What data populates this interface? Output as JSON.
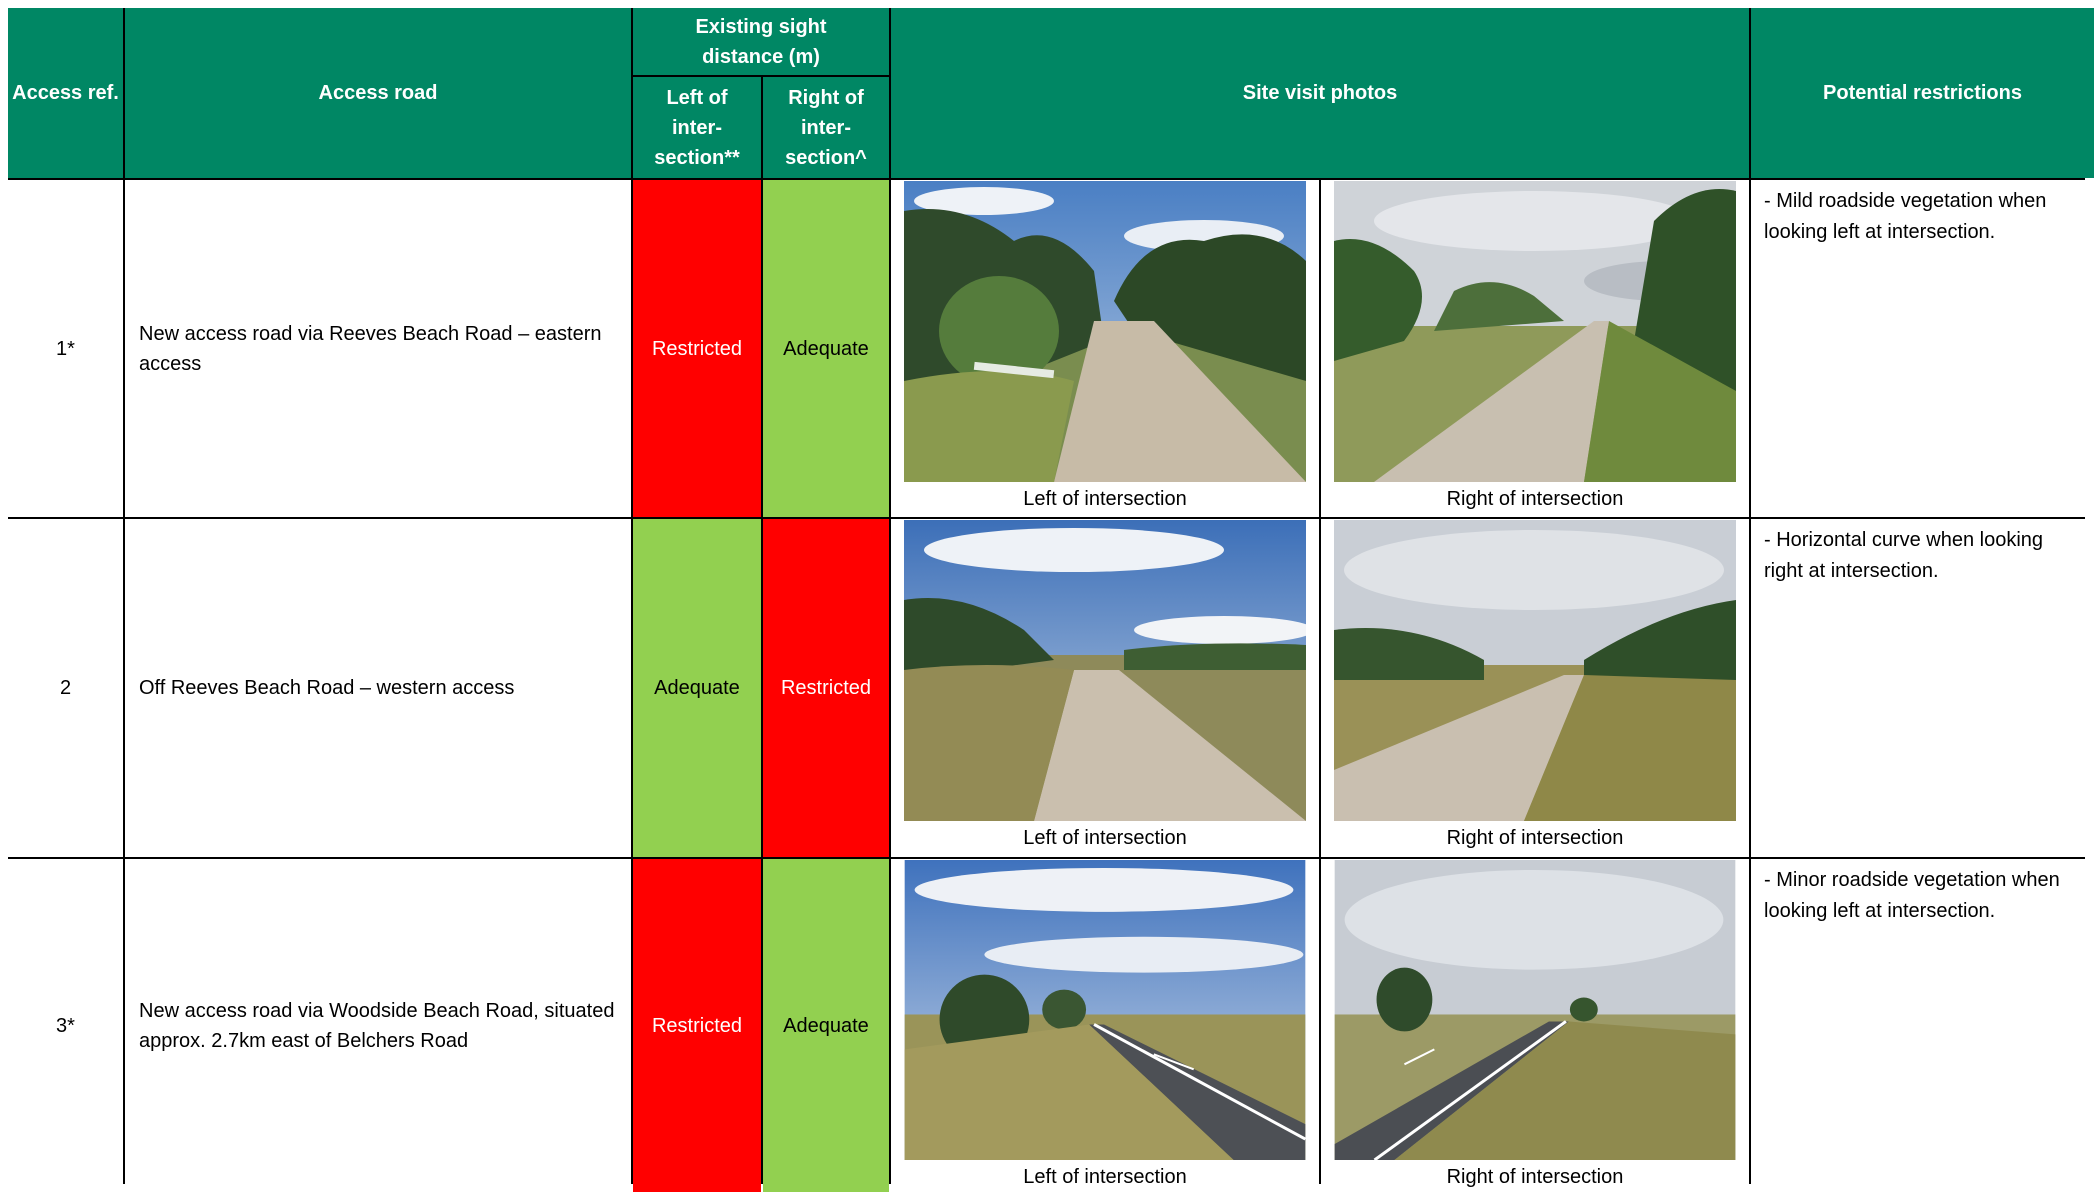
{
  "header": {
    "access_ref": "Access ref.",
    "access_road": "Access road",
    "sight_distance": "Existing sight distance (m)",
    "left_col": "Left of inter-section**",
    "right_col": "Right of inter-section^",
    "photos": "Site visit photos",
    "restrictions": "Potential restrictions"
  },
  "colors": {
    "header": "#008764",
    "restricted": "#ff0000",
    "adequate": "#92d050"
  },
  "rows": [
    {
      "ref": "1*",
      "road": "New access road via Reeves Beach Road – eastern access",
      "left": "Restricted",
      "right": "Adequate",
      "left_caption": "Left of intersection",
      "right_caption": "Right of intersection",
      "restriction": "- Mild roadside vegetation when looking left at intersection."
    },
    {
      "ref": "2",
      "road": "Off Reeves Beach Road – western access",
      "left": "Adequate",
      "right": "Restricted",
      "left_caption": "Left of intersection",
      "right_caption": "Right of intersection",
      "restriction": "- Horizontal curve when looking right at intersection."
    },
    {
      "ref": "3*",
      "road": "New access road via Woodside Beach Road, situated approx. 2.7km east of Belchers Road",
      "left": "Restricted",
      "right": "Adequate",
      "left_caption": "Left of intersection",
      "right_caption": "Right of intersection",
      "restriction": "- Minor roadside vegetation when looking left at intersection."
    }
  ]
}
